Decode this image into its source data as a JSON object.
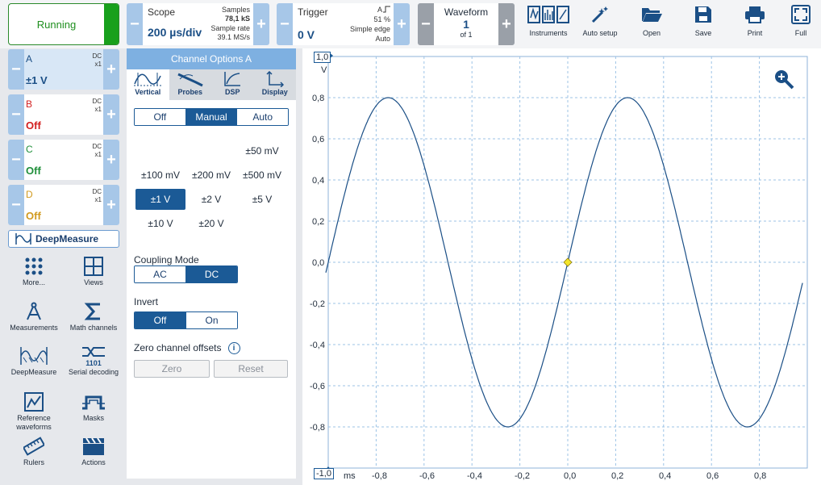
{
  "toolbar": {
    "run_label": "Running",
    "scope": {
      "label": "Scope",
      "value": "200 µs/div",
      "samples_label": "Samples",
      "samples_value": "78,1 kS",
      "rate_label": "Sample rate",
      "rate_value": "39.1 MS/s"
    },
    "trigger": {
      "label": "Trigger",
      "value": "0 V",
      "channel": "A",
      "percent": "51 %",
      "type": "Simple edge",
      "mode": "Auto"
    },
    "waveform": {
      "label": "Waveform",
      "value": "1",
      "of": "of 1"
    },
    "tools": [
      "Instruments",
      "Auto setup",
      "Open",
      "Save",
      "Print",
      "Full"
    ],
    "minus": "−",
    "plus": "+"
  },
  "channels": [
    {
      "name": "A",
      "coupling": "DC",
      "probe": "x1",
      "state": "±1 V",
      "color": "#1b4f86"
    },
    {
      "name": "B",
      "coupling": "DC",
      "probe": "x1",
      "state": "Off",
      "color": "#d21f1f"
    },
    {
      "name": "C",
      "coupling": "DC",
      "probe": "x1",
      "state": "Off",
      "color": "#1f8f3a"
    },
    {
      "name": "D",
      "coupling": "DC",
      "probe": "x1",
      "state": "Off",
      "color": "#d19a1f"
    }
  ],
  "deepmeasure_label": "DeepMeasure",
  "tiles": [
    "More...",
    "Views",
    "Measurements",
    "Math channels",
    "DeepMeasure",
    "Serial decoding",
    "Reference waveforms",
    "Masks",
    "Rulers",
    "Actions"
  ],
  "serial_code": "1101",
  "panel": {
    "title": "Channel Options A",
    "tabs": [
      "Vertical",
      "Probes",
      "DSP",
      "Display"
    ],
    "range_mode": [
      "Off",
      "Manual",
      "Auto"
    ],
    "ranges": [
      "±50 mV",
      "±100 mV",
      "±200 mV",
      "±500 mV",
      "±1 V",
      "±2 V",
      "±5 V",
      "±10 V",
      "±20 V"
    ],
    "selected_range": "±1 V",
    "coupling_title": "Coupling Mode",
    "coupling": [
      "AC",
      "DC"
    ],
    "invert_title": "Invert",
    "invert": [
      "Off",
      "On"
    ],
    "zero_title": "Zero channel offsets",
    "info_glyph": "i",
    "zero_btn": "Zero",
    "reset_btn": "Reset"
  },
  "plot": {
    "y_top": "1,0",
    "y_unit": "V",
    "y_bottom": "-1,0",
    "x_unit": "ms",
    "y_ticks": [
      "0,8",
      "0,6",
      "0,4",
      "0,2",
      "0,0",
      "-0,2",
      "-0,4",
      "-0,6",
      "-0,8"
    ],
    "x_ticks": [
      "-1,0",
      "-0,8",
      "-0,6",
      "-0,4",
      "-0,2",
      "0,0",
      "0,2",
      "0,4",
      "0,6",
      "0,8"
    ]
  },
  "chart_data": {
    "type": "line",
    "title": "",
    "xlabel": "ms",
    "ylabel": "V",
    "xlim": [
      -1.0,
      1.0
    ],
    "ylim": [
      -1.0,
      1.0
    ],
    "grid": true,
    "series": [
      {
        "name": "",
        "color": "#1b4f86",
        "amplitude": 0.8,
        "period_ms": 1.0,
        "phase_zero_crossing_ms": 0.0,
        "x_start": -1.01,
        "x_end": 0.98
      }
    ],
    "trigger_point": {
      "x": 0.0,
      "y": 0.0
    }
  }
}
